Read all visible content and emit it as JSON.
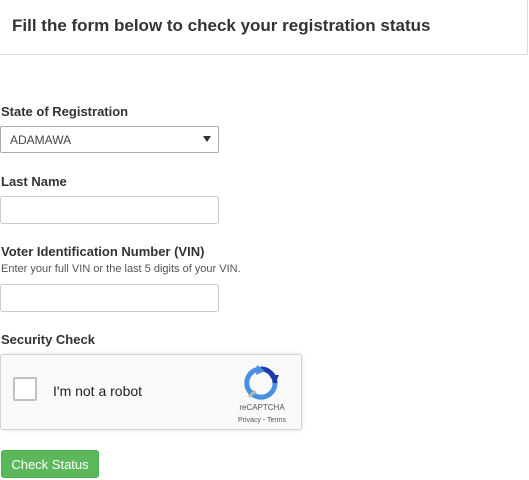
{
  "header": {
    "title": "Fill the form below to check your registration status"
  },
  "form": {
    "state": {
      "label": "State of Registration",
      "selected_value": "ADAMAWA"
    },
    "last_name": {
      "label": "Last Name",
      "value": ""
    },
    "vin": {
      "label": "Voter Identification Number (VIN)",
      "help": "Enter your full VIN or the last 5 digits of your VIN.",
      "value": ""
    },
    "security": {
      "label": "Security Check"
    },
    "recaptcha": {
      "checkbox_label": "I'm not a robot",
      "brand": "reCAPTCHA",
      "privacy": "Privacy",
      "separator": " - ",
      "terms": "Terms",
      "logo_icon": "recaptcha-logo-icon"
    },
    "submit_label": "Check Status"
  },
  "colors": {
    "submit_bg": "#5cb85c",
    "recaptcha_blue": "#4a90e2",
    "recaptcha_dark": "#1c3aa9",
    "recaptcha_gray": "#b7b7b7"
  }
}
